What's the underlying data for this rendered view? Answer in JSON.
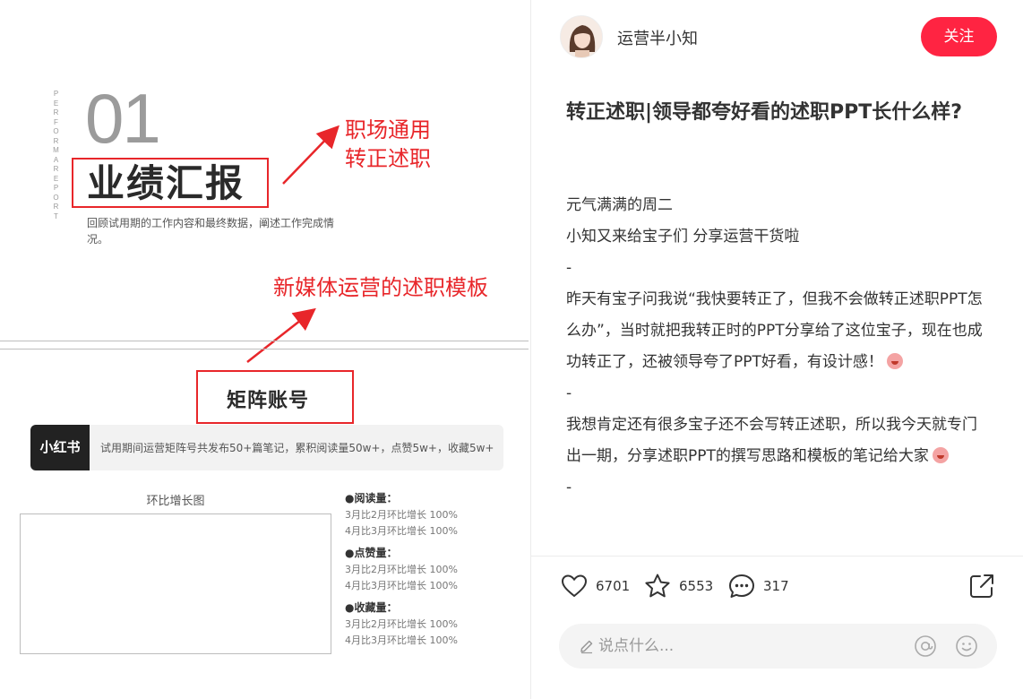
{
  "slide": {
    "vertical_text": "PERFORMA REPORT",
    "number": "01",
    "title": "业绩汇报",
    "description": "回顾试用期的工作内容和最终数据，阐述工作完成情况。",
    "annotation_1": "职场通用\n转正述职",
    "annotation_2": "新媒体运营的述职模板",
    "matrix_label": "矩阵账号",
    "platform_tag": "小红书",
    "platform_text": "试用期间运营矩阵号共发布50+篇笔记，累积阅读量50w+，点赞5w+，收藏5w+",
    "chart_title": "环比增长图",
    "stats": [
      {
        "head": "●阅读量：",
        "lines": [
          "3月比2月环比增长 100%",
          "4月比3月环比增长 100%"
        ]
      },
      {
        "head": "●点赞量：",
        "lines": [
          "3月比2月环比增长 100%",
          "4月比3月环比增长 100%"
        ]
      },
      {
        "head": "●收藏量：",
        "lines": [
          "3月比2月环比增长 100%",
          "4月比3月环比增长 100%"
        ]
      }
    ],
    "accent_color": "#e8262a"
  },
  "author": {
    "name": "运营半小知",
    "follow_label": "关注"
  },
  "post": {
    "title": "转正述职|领导都夸好看的述职PPT长什么样?",
    "paragraphs": [
      "元气满满的周二",
      "小知又来给宝子们 分享运营干货啦",
      "-",
      "昨天有宝子问我说“我快要转正了，但我不会做转正述职PPT怎么办”，当时就把我转正时的PPT分享给了这位宝子，现在也成功转正了，还被领导夸了PPT好看，有设计感！",
      "-",
      "我想肯定还有很多宝子还不会写转正述职，所以我今天就专门出一期，分享述职PPT的撰写思路和模板的笔记给大家",
      "-"
    ]
  },
  "actions": {
    "like_count": "6701",
    "collect_count": "6553",
    "comment_count": "317"
  },
  "comment": {
    "placeholder": "说点什么..."
  },
  "colors": {
    "brand": "#ff2442",
    "annotation": "#e8262a"
  }
}
